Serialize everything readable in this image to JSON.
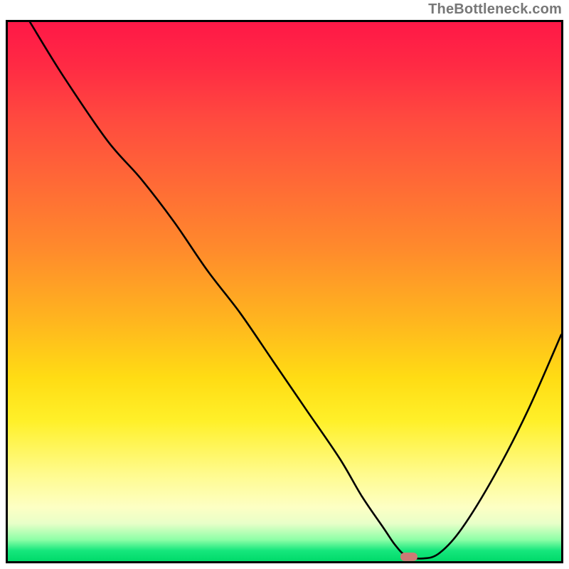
{
  "attribution": "TheBottleneck.com",
  "chart_data": {
    "type": "line",
    "title": "",
    "xlabel": "",
    "ylabel": "",
    "xlim": [
      0,
      100
    ],
    "ylim": [
      0,
      100
    ],
    "series": [
      {
        "name": "bottleneck-curve",
        "x": [
          4,
          10,
          18,
          24,
          30,
          36,
          42,
          48,
          54,
          60,
          64,
          68,
          70,
          72,
          75,
          78,
          82,
          88,
          94,
          100
        ],
        "y": [
          100,
          90,
          78,
          71,
          63,
          54,
          46,
          37,
          28,
          19,
          12,
          6,
          3,
          1,
          0.5,
          1.5,
          6,
          16,
          28,
          42
        ]
      }
    ],
    "annotations": [
      {
        "name": "minimum-marker",
        "x": 72.5,
        "y": 0.8,
        "color": "#cc7a75"
      }
    ],
    "background_gradient": {
      "stops": [
        {
          "pos": 0.0,
          "color": "#ff1847"
        },
        {
          "pos": 0.3,
          "color": "#ff6a36"
        },
        {
          "pos": 0.55,
          "color": "#ffb41f"
        },
        {
          "pos": 0.74,
          "color": "#fff029"
        },
        {
          "pos": 0.9,
          "color": "#fdffc4"
        },
        {
          "pos": 1.0,
          "color": "#00da6a"
        }
      ]
    }
  }
}
